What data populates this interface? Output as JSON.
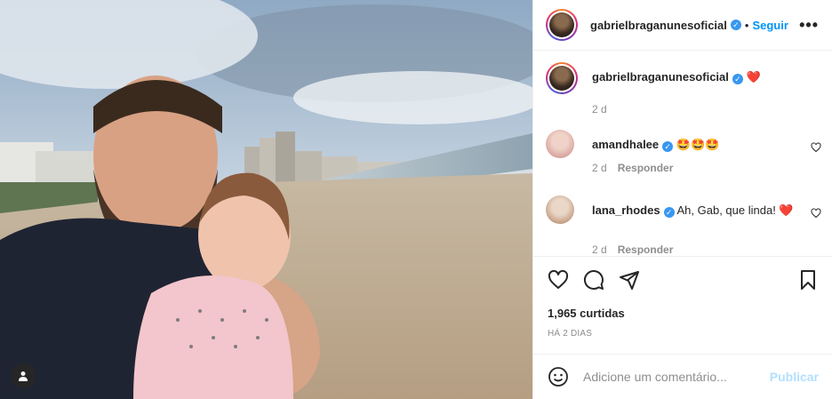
{
  "post": {
    "author": "gabrielbraganunesoficial",
    "follow_label": "Seguir",
    "more_label": "•••",
    "dot": "•"
  },
  "comments": [
    {
      "user": "gabrielbraganunesoficial",
      "text": "❤️",
      "time": "2 d",
      "reply": ""
    },
    {
      "user": "amandhalee",
      "text": "🤩🤩🤩",
      "time": "2 d",
      "reply": "Responder"
    },
    {
      "user": "lana_rhodes",
      "text": "Ah, Gab, que linda! ❤️",
      "time": "2 d",
      "reply": "Responder"
    }
  ],
  "stats": {
    "likes": "1,965 curtidas",
    "ago": "HÁ 2 DIAS"
  },
  "composer": {
    "placeholder": "Adicione um comentário...",
    "publish_label": "Publicar"
  },
  "icons": {
    "heart": "heart-icon",
    "comment": "comment-icon",
    "share": "paper-plane-icon",
    "save": "bookmark-icon",
    "emoji": "smiley-icon",
    "tag": "user-tag-icon"
  },
  "colors": {
    "link": "#0095f6",
    "verified": "#3897f0",
    "publish_disabled": "#b2dffc",
    "muted": "#8e8e8e",
    "heart_red": "#ed1c24"
  }
}
